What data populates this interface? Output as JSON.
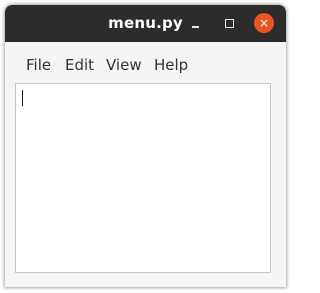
{
  "window": {
    "title": "menu.py",
    "controls": {
      "minimize": "minimize",
      "maximize": "maximize",
      "close": "×"
    }
  },
  "menubar": {
    "items": [
      {
        "label": "File"
      },
      {
        "label": "Edit"
      },
      {
        "label": "View"
      },
      {
        "label": "Help"
      }
    ]
  },
  "editor": {
    "text": ""
  },
  "colors": {
    "titlebar": "#2c2c2c",
    "close_button": "#e95420",
    "window_bg": "#f6f5f4",
    "editor_bg": "#ffffff"
  }
}
